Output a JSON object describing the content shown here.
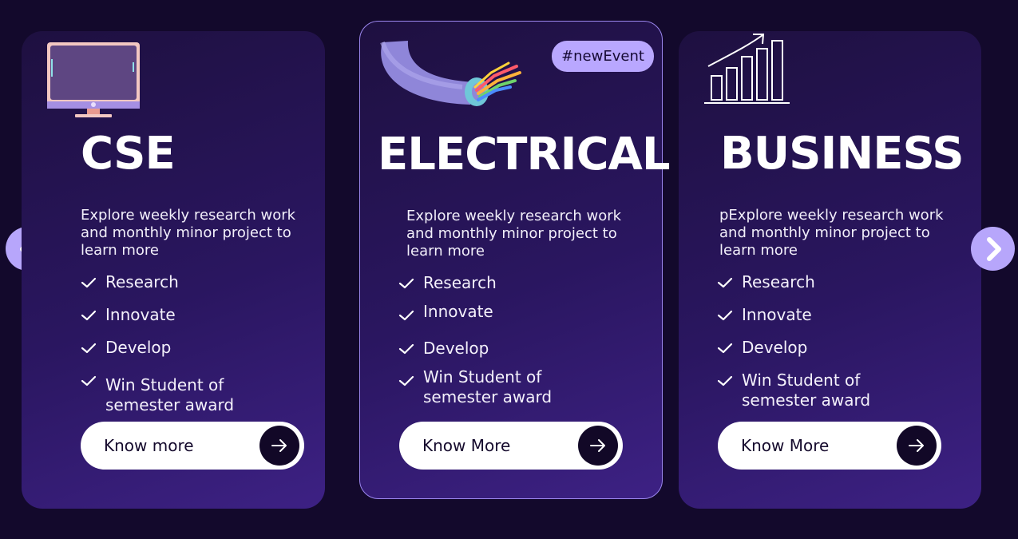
{
  "carousel": {
    "prev_icon": "chevron-left-icon",
    "next_icon": "chevron-right-icon",
    "nav_color": "#b7a6fb"
  },
  "cards": [
    {
      "id": "cse",
      "icon": "computer-monitor-icon",
      "title": "CSE",
      "description": "Explore weekly research work and monthly minor project to learn more",
      "features": [
        "Research",
        "Innovate",
        "Develop",
        "Win Student of semester award"
      ],
      "button_label": "Know more",
      "button_icon": "arrow-right-icon"
    },
    {
      "id": "electrical",
      "icon": "electric-cable-icon",
      "badge": "#newEvent",
      "title": "ELECTRICAL",
      "description": "Explore weekly research work and monthly minor project to learn more",
      "features": [
        "Research",
        "Innovate",
        "Develop",
        "Win Student of semester award"
      ],
      "button_label": "Know More",
      "button_icon": "arrow-right-icon"
    },
    {
      "id": "business",
      "icon": "growth-chart-icon",
      "title": "BUSINESS",
      "description": "pExplore weekly research work and monthly minor project to learn more",
      "features": [
        "Research",
        "Innovate",
        "Develop",
        "Win Student of semester award"
      ],
      "button_label": "Know More",
      "button_icon": "arrow-right-icon"
    }
  ],
  "colors": {
    "background": "#13092c",
    "card_gradient_end": "#3d2184",
    "badge": "#b9a7ff",
    "button_bg": "#ffffff",
    "button_arrow_bg": "#120827"
  }
}
